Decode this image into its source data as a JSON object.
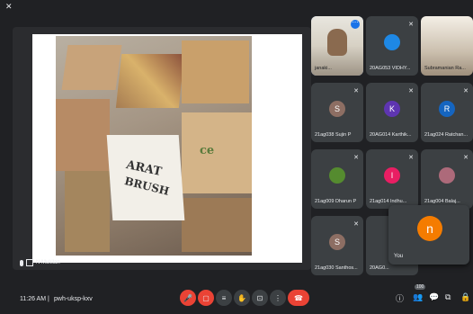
{
  "presenter_name": "N Mukilan",
  "slide_photo_text": [
    "ARAT",
    "BRUSH",
    "ce"
  ],
  "tiles": [
    {
      "name": "janaki...",
      "initial": "",
      "color": "",
      "type": "camera",
      "muted": false
    },
    {
      "name": "20AG053 VIDHY...",
      "initial": "",
      "color": "#1e88e5",
      "type": "avatar-img",
      "muted": true
    },
    {
      "name": "Subramanian Ra...",
      "initial": "",
      "color": "",
      "type": "photo",
      "muted": false
    },
    {
      "name": "21ag038 Sujin P",
      "initial": "S",
      "color": "#8d6e63",
      "type": "letter",
      "muted": true
    },
    {
      "name": "20AG014 Karthik...",
      "initial": "K",
      "color": "#5e35b1",
      "type": "letter",
      "muted": true
    },
    {
      "name": "21ag024 Ratchan...",
      "initial": "R",
      "color": "#1565c0",
      "type": "letter",
      "muted": true
    },
    {
      "name": "21ag009 Dharun P",
      "initial": "",
      "color": "#558b2f",
      "type": "avatar-img",
      "muted": true
    },
    {
      "name": "21ag014 Indhu...",
      "initial": "I",
      "color": "#e91e63",
      "type": "letter",
      "muted": true
    },
    {
      "name": "21ag004 Balaj...",
      "initial": "",
      "color": "#ad6a7a",
      "type": "avatar-img",
      "muted": true
    },
    {
      "name": "21ag030 Santhos...",
      "initial": "S",
      "color": "#8d6e63",
      "type": "letter",
      "muted": true
    },
    {
      "name": "20AG0...",
      "initial": "",
      "color": "",
      "type": "blank",
      "muted": true
    }
  ],
  "you": {
    "label": "You",
    "initial": "n",
    "color": "#f57c00"
  },
  "meeting": {
    "time": "11:26 AM",
    "separator": "|",
    "code": "pwh-uksp-kxv"
  },
  "participant_count": "100"
}
